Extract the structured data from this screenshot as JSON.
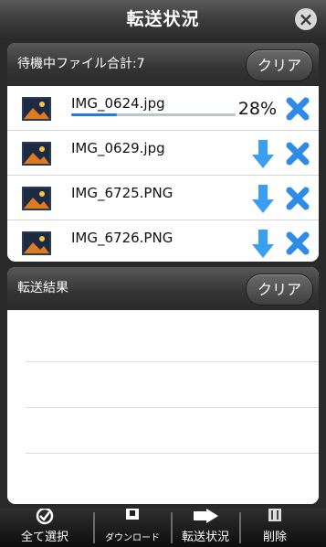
{
  "header": {
    "title": "転送状況",
    "close_icon": "close-icon"
  },
  "queue": {
    "label": "待機中ファイル合計:7",
    "clear_label": "クリア",
    "items": [
      {
        "name": "IMG_0624.jpg",
        "progress_text": "28%",
        "progress": 0.28,
        "status": "uploading"
      },
      {
        "name": "IMG_0629.jpg",
        "status": "waiting"
      },
      {
        "name": "IMG_6725.PNG",
        "status": "waiting"
      },
      {
        "name": "IMG_6726.PNG",
        "status": "waiting"
      }
    ]
  },
  "results": {
    "label": "転送結果",
    "clear_label": "クリア"
  },
  "toolbar": {
    "items": [
      {
        "label": "全て選択",
        "icon": "check-circle-icon"
      },
      {
        "label": "ダウンロード",
        "icon": "download-icon"
      },
      {
        "label": "転送状況",
        "icon": "transfer-arrow-icon"
      },
      {
        "label": "削除",
        "icon": "trash-icon"
      }
    ]
  },
  "colors": {
    "accent": "#1e7fd8",
    "arrow_blue": "#3a9ff2"
  }
}
